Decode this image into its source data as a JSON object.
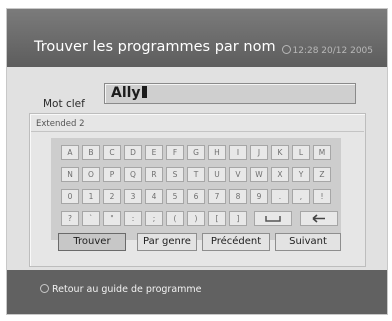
{
  "header": {
    "title": "Trouver les programmes par nom",
    "clock": "12:28 20/12 2005",
    "clock_icon": "clock-icon"
  },
  "keyword": {
    "label": "Mot clef",
    "value": "Ally"
  },
  "keyboard": {
    "mode": "Extended 2",
    "rows": [
      [
        "A",
        "B",
        "C",
        "D",
        "E",
        "F",
        "G",
        "H",
        "I",
        "J",
        "K",
        "L",
        "M"
      ],
      [
        "N",
        "O",
        "P",
        "Q",
        "R",
        "S",
        "T",
        "U",
        "V",
        "W",
        "X",
        "Y",
        "Z"
      ],
      [
        "0",
        "1",
        "2",
        "3",
        "4",
        "5",
        "6",
        "7",
        "8",
        "9",
        ".",
        ",",
        "!"
      ],
      [
        "?",
        "`",
        "\"",
        ":",
        ";",
        "(",
        ")",
        "[",
        "]"
      ]
    ],
    "space_key": "space-icon",
    "backspace_key": "arrow-left-icon"
  },
  "buttons": {
    "trouver": "Trouver",
    "par_genre": "Par genre",
    "precedent": "Précédent",
    "suivant": "Suivant"
  },
  "footer": {
    "text": "Retour au guide de programme",
    "icon": "circle-button-icon"
  }
}
